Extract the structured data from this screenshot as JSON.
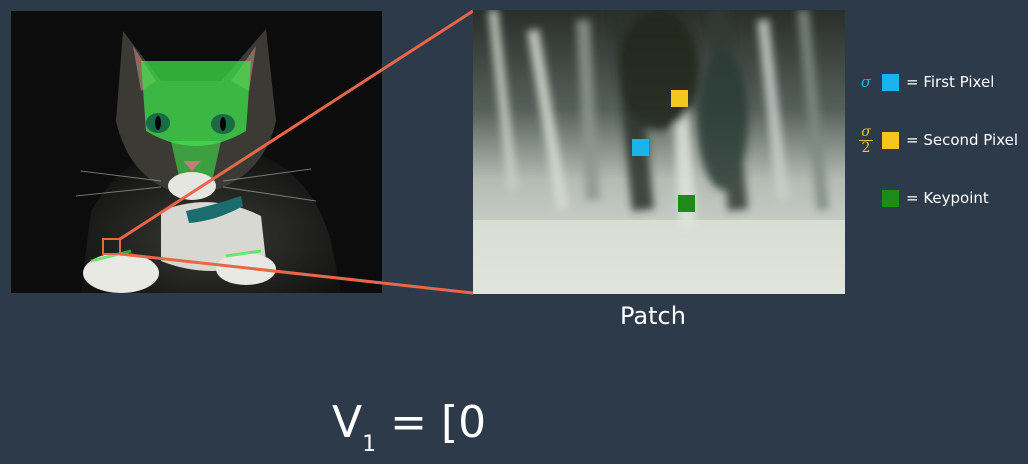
{
  "patch": {
    "caption": "Patch"
  },
  "legend": {
    "items": [
      {
        "symbol": "σ",
        "label": "= First Pixel",
        "color": "#1bb3ea",
        "symbol_color": "#1bb3ea"
      },
      {
        "symbol_num": "σ",
        "symbol_den": "2",
        "label": "= Second Pixel",
        "color": "#f2c71f",
        "symbol_color": "#e8c23a"
      },
      {
        "label": "= Keypoint",
        "color": "#1f8a1a"
      }
    ]
  },
  "formula": {
    "base": "V",
    "subscript": "1",
    "rest": " = [0"
  },
  "colors": {
    "background": "#2d3a4a",
    "zoom_line": "#e8664a",
    "keypoint_overlay": "#3fe24a"
  }
}
